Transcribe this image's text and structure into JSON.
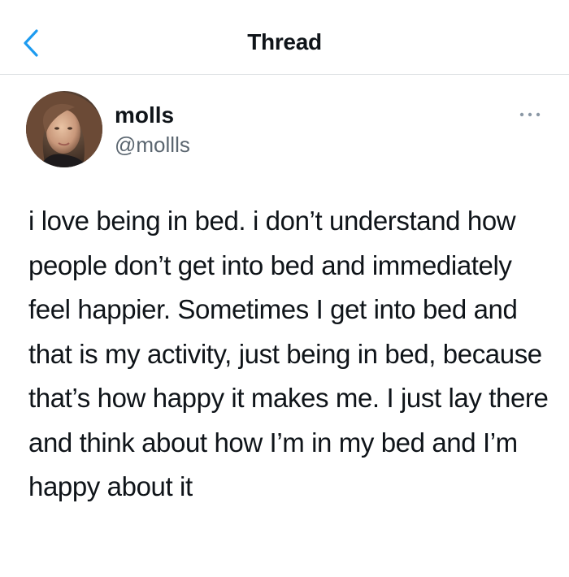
{
  "header": {
    "title": "Thread",
    "back_icon": "chevron-left-icon"
  },
  "tweet": {
    "author": {
      "display_name": "molls",
      "handle": "@mollls",
      "avatar_icon": "avatar-photo"
    },
    "more_icon": "more-dots-icon",
    "text": "i love being in bed. i don’t understand how people don’t get into bed and immediately feel happier. Sometimes I get into bed and that is my activity, just being in bed, because that’s how happy it makes me. I just lay there and think about how I’m in my bed and I’m happy about it"
  },
  "colors": {
    "accent": "#1d9bf0",
    "text_primary": "#0f1419",
    "text_secondary": "#5b6670",
    "divider": "#dcdfe2"
  }
}
